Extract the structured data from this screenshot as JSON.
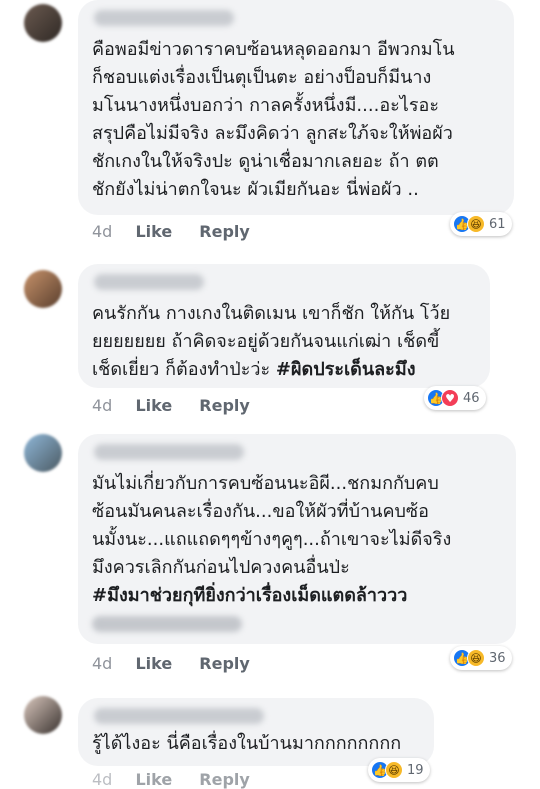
{
  "comments": [
    {
      "text": "คือพอมีข่าวดาราคบซ้อนหลุดออกมา อีพวกมโน\nก็ชอบแต่งเรื่องเป็นตุเป็นตะ อย่างป็อบก็มีนาง\nมโนนางหนึ่งบอกว่า กาลครั้งหนึ่งมี....อะไรอะ\nสรุปคือไม่มีจริง ละมึงคิดว่า ลูกสะใภ้จะให้พ่อผัว\nชักเกงในให้จริงปะ ดูน่าเชื่อมากเลยอะ ถ้า ตต\nชักยังไม่น่าตกใจนะ ผัวเมียกันอะ นี่พ่อผัว ..",
      "tag": "",
      "time": "4d",
      "like": "Like",
      "reply": "Reply",
      "reactions": [
        "like-icon",
        "haha-icon"
      ],
      "count": "61"
    },
    {
      "text": "คนรักกัน กางเกงในติดเมน เขาก็ชัก ให้กัน โว้ย\nยยยยยยย ถ้าคิดจะอยู่ด้วยกันจนแก่เฒ่า เช็ดขี้\nเช็ดเยี่ยว ก็ต้องทำป่ะว่ะ",
      "tag": "#ผิดประเด็นละมึง",
      "time": "4d",
      "like": "Like",
      "reply": "Reply",
      "reactions": [
        "like-icon",
        "love-icon"
      ],
      "count": "46"
    },
    {
      "text": "มันไม่เกี่ยวกับการคบซ้อนนะอิผี...ชกมกกับคบ\nซ้อนมันคนละเรื่องกัน...ขอให้ผัวที่บ้านคบซ้อ\nนมั้งนะ...แถแถดๆๆข้างๆคูๆ...ถ้าเขาจะไม่ดีจริง\nมึงควรเลิกกันก่อนไปควงคนอื่นป่ะ",
      "tag": "#มึงมาช่วยกุทียิ่งกว่าเรื่องเม็ดแตดล้าววว",
      "time": "4d",
      "like": "Like",
      "reply": "Reply",
      "reactions": [
        "like-icon",
        "haha-icon"
      ],
      "count": "36"
    },
    {
      "text": "รู้ได้ไงอะ นี่คือเรื่องในบ้านมากกกกกกกก",
      "tag": "",
      "time": "4d",
      "like": "Like",
      "reply": "Reply",
      "reactions": [
        "like-icon",
        "haha-icon"
      ],
      "count": "19"
    }
  ],
  "colors": {
    "accent": "#1877f2",
    "bubble": "#f2f3f5",
    "love": "#f33e58",
    "haha": "#f7b928"
  }
}
